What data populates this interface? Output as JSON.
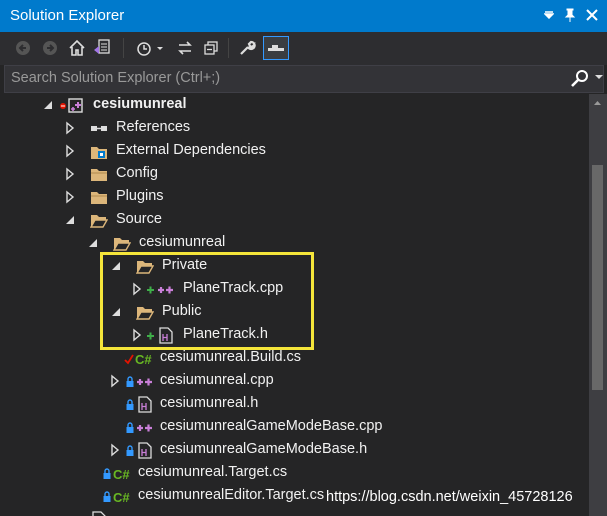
{
  "window": {
    "title": "Solution Explorer",
    "buttons": {
      "dropdown": "▼",
      "pin": "📌",
      "close": "✕"
    }
  },
  "toolbar": {
    "items": [
      {
        "name": "back-icon"
      },
      {
        "name": "forward-icon"
      },
      {
        "name": "home-icon"
      },
      {
        "name": "switch-views-icon"
      },
      {
        "name": "history-icon"
      },
      {
        "name": "sync-icon"
      },
      {
        "name": "collapse-all-icon"
      },
      {
        "name": "properties-wrench-icon"
      },
      {
        "name": "preview-selected-icon"
      }
    ]
  },
  "search": {
    "placeholder": "Search Solution Explorer (Ctrl+;)"
  },
  "tree": [
    {
      "label": "cesiumunreal",
      "bold": true,
      "expander": "expanded",
      "icon": "project-icon",
      "prefix": "red-dot"
    },
    {
      "label": "References",
      "expander": "collapsed",
      "icon": "references-icon"
    },
    {
      "label": "External Dependencies",
      "expander": "collapsed",
      "icon": "external-deps-icon"
    },
    {
      "label": "Config",
      "expander": "collapsed",
      "icon": "folder-icon"
    },
    {
      "label": "Plugins",
      "expander": "collapsed",
      "icon": "folder-icon"
    },
    {
      "label": "Source",
      "expander": "expanded",
      "icon": "folder-open-icon"
    },
    {
      "label": "cesiumunreal",
      "expander": "expanded",
      "icon": "folder-open-icon"
    },
    {
      "label": "Private",
      "expander": "expanded",
      "icon": "folder-open-icon"
    },
    {
      "label": "PlaneTrack.cpp",
      "expander": "collapsed",
      "icon": "cpp-file-icon",
      "prefix": "plus"
    },
    {
      "label": "Public",
      "expander": "expanded",
      "icon": "folder-open-icon"
    },
    {
      "label": "PlaneTrack.h",
      "expander": "collapsed",
      "icon": "h-file-icon",
      "prefix": "plus"
    },
    {
      "label": "cesiumunreal.Build.cs",
      "icon": "csharp-file-icon",
      "prefix": "check"
    },
    {
      "label": "cesiumunreal.cpp",
      "expander": "collapsed",
      "icon": "cpp-file-icon",
      "prefix": "lock"
    },
    {
      "label": "cesiumunreal.h",
      "icon": "h-file-icon",
      "prefix": "lock"
    },
    {
      "label": "cesiumunrealGameModeBase.cpp",
      "icon": "cpp-file-icon",
      "prefix": "lock"
    },
    {
      "label": "cesiumunrealGameModeBase.h",
      "expander": "collapsed",
      "icon": "h-file-icon",
      "prefix": "lock"
    },
    {
      "label": "cesiumunreal.Target.cs",
      "icon": "csharp-file-icon",
      "prefix": "lock"
    },
    {
      "label": "cesiumunrealEditor.Target.cs",
      "icon": "csharp-file-icon",
      "prefix": "lock"
    }
  ],
  "watermark": "https://blog.csdn.net/weixin_45728126",
  "colors": {
    "titlebar": "#007acc",
    "background": "#252526",
    "highlight": "#f5e53a",
    "folder": "#dcb67a",
    "plus": "#3fae49",
    "cpp": "#c97fd8",
    "csharp": "#68b723"
  }
}
